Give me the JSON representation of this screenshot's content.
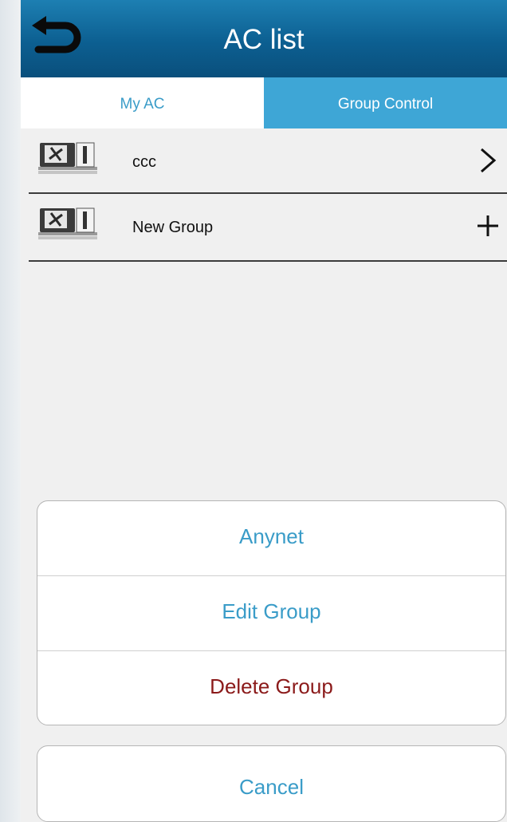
{
  "header": {
    "title": "AC list",
    "background_color": "#0c5f91"
  },
  "tabs": [
    {
      "label": "My AC",
      "active": false
    },
    {
      "label": "Group Control",
      "active": true
    }
  ],
  "list": {
    "items": [
      {
        "label": "ccc",
        "action_icon": "chevron-right-icon"
      },
      {
        "label": "New Group",
        "action_icon": "plus-icon"
      }
    ]
  },
  "sheet": {
    "options": [
      {
        "label": "Anynet",
        "color": "#3a9cc8"
      },
      {
        "label": "Edit Group",
        "color": "#3a9cc8"
      },
      {
        "label": "Delete Group",
        "color": "#8b1a1a"
      }
    ],
    "cancel_label": "Cancel"
  },
  "colors": {
    "accent": "#3a9cc8",
    "tab_active_bg": "#3ea6d6",
    "danger": "#8b1a1a"
  }
}
